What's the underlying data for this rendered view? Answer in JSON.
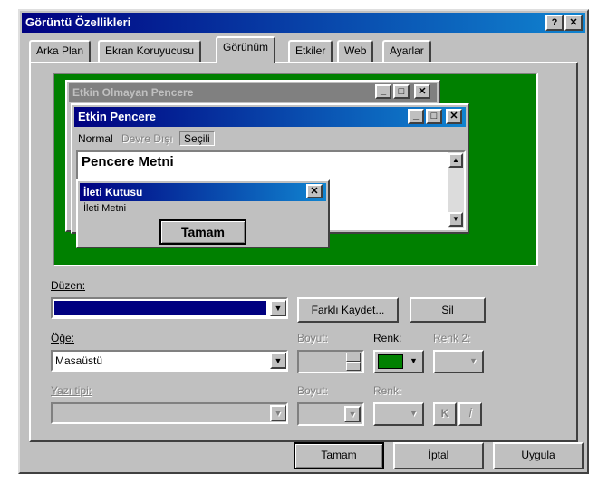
{
  "window": {
    "title": "Görüntü Özellikleri",
    "help_btn": "?",
    "close_btn": "✕"
  },
  "tabs": [
    "Arka Plan",
    "Ekran Koruyucusu",
    "Görünüm",
    "Etkiler",
    "Web",
    "Ayarlar"
  ],
  "active_tab_index": 2,
  "preview": {
    "inactive_title": "Etkin Olmayan Pencere",
    "active_title": "Etkin Pencere",
    "menu_normal": "Normal",
    "menu_disabled": "Devre Dışı",
    "menu_selected": "Seçili",
    "window_text": "Pencere Metni",
    "msgbox_title": "İleti Kutusu",
    "msgbox_text": "İleti Metni",
    "msgbox_ok": "Tamam",
    "bg_color": "#008000"
  },
  "scheme": {
    "label": "Düzen:",
    "value": "",
    "saveas_label": "Farklı Kaydet...",
    "delete_label": "Sil"
  },
  "item": {
    "label": "Öğe:",
    "value": "Masaüstü",
    "size_label": "Boyut:",
    "color_label": "Renk:",
    "color2_label": "Renk 2:",
    "color_value": "#008000"
  },
  "font": {
    "label": "Yazı tipi:",
    "size_label": "Boyut:",
    "color_label": "Renk:",
    "bold_label": "K",
    "italic_label": "İ"
  },
  "footer": {
    "ok_label": "Tamam",
    "cancel_label": "İptal",
    "apply_label": "Uygula"
  }
}
